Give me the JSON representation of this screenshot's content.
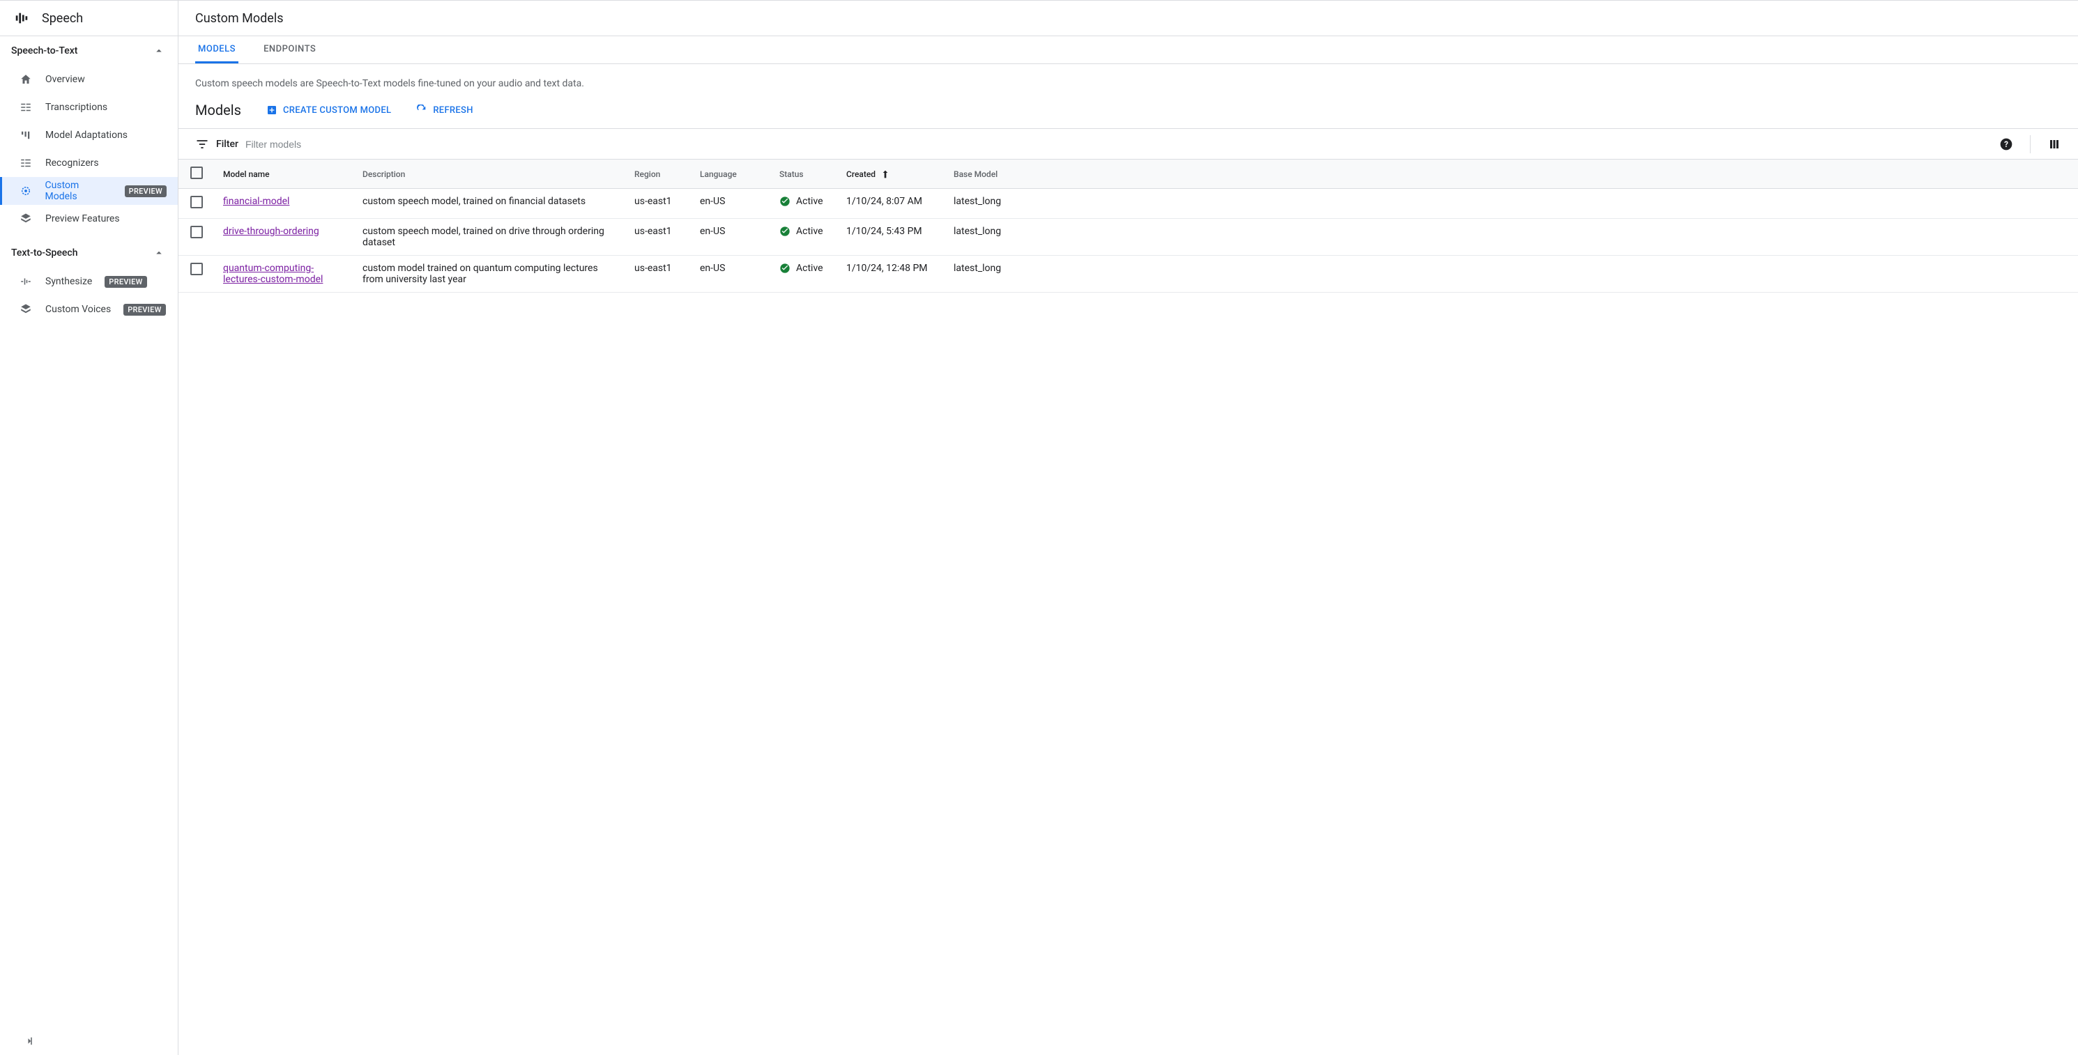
{
  "product": {
    "name": "Speech"
  },
  "sidebar": {
    "sections": [
      {
        "title": "Speech-to-Text",
        "items": [
          {
            "label": "Overview"
          },
          {
            "label": "Transcriptions"
          },
          {
            "label": "Model Adaptations"
          },
          {
            "label": "Recognizers"
          },
          {
            "label": "Custom Models",
            "badge": "PREVIEW"
          },
          {
            "label": "Preview Features"
          }
        ]
      },
      {
        "title": "Text-to-Speech",
        "items": [
          {
            "label": "Synthesize",
            "badge": "PREVIEW"
          },
          {
            "label": "Custom Voices",
            "badge": "PREVIEW"
          }
        ]
      }
    ]
  },
  "page": {
    "title": "Custom Models",
    "tabs": {
      "models": "MODELS",
      "endpoints": "ENDPOINTS"
    },
    "description": "Custom speech models are Speech-to-Text models fine-tuned on your audio and text data.",
    "section_title": "Models",
    "actions": {
      "create": "CREATE CUSTOM MODEL",
      "refresh": "REFRESH"
    },
    "filter": {
      "label": "Filter",
      "placeholder": "Filter models"
    }
  },
  "table": {
    "columns": {
      "name": "Model name",
      "description": "Description",
      "region": "Region",
      "language": "Language",
      "status": "Status",
      "created": "Created",
      "base": "Base Model"
    },
    "rows": [
      {
        "name": "financial-model",
        "description": "custom speech model, trained on financial datasets",
        "region": "us-east1",
        "language": "en-US",
        "status": "Active",
        "created": "1/10/24, 8:07 AM",
        "base": "latest_long"
      },
      {
        "name": "drive-through-ordering",
        "description": "custom speech model, trained on drive through ordering dataset",
        "region": "us-east1",
        "language": "en-US",
        "status": "Active",
        "created": "1/10/24, 5:43 PM",
        "base": "latest_long"
      },
      {
        "name": "quantum-computing-lectures-custom-model",
        "description": "custom model trained on quantum computing lectures from university last year",
        "region": "us-east1",
        "language": "en-US",
        "status": "Active",
        "created": "1/10/24, 12:48 PM",
        "base": "latest_long"
      }
    ]
  },
  "status_color": "#188038"
}
